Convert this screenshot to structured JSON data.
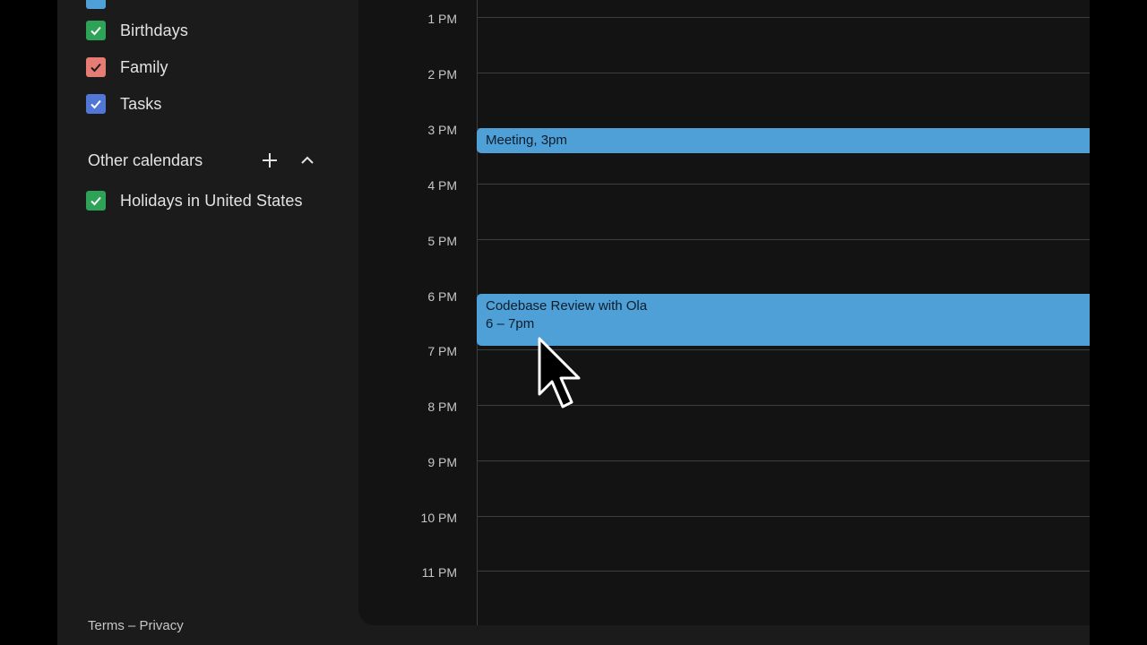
{
  "sidebar": {
    "my_calendars": [
      {
        "label": "Birthdays",
        "color": "#2ea358",
        "checked": true
      },
      {
        "label": "Family",
        "color": "#e67c73",
        "checked": true
      },
      {
        "label": "Tasks",
        "color": "#5177d6",
        "checked": true
      }
    ],
    "partial_top_item_color": "#4fa0d6",
    "other_calendars": {
      "title": "Other calendars",
      "add_icon": "plus-icon",
      "collapse_icon": "chevron-up-icon",
      "items": [
        {
          "label": "Holidays in United States",
          "color": "#2ea358",
          "checked": true
        }
      ]
    },
    "footer": {
      "terms": "Terms",
      "separator": "–",
      "privacy": "Privacy"
    }
  },
  "grid": {
    "hours": [
      "1 PM",
      "2 PM",
      "3 PM",
      "4 PM",
      "5 PM",
      "6 PM",
      "7 PM",
      "8 PM",
      "9 PM",
      "10 PM",
      "11 PM"
    ]
  },
  "events": [
    {
      "title": "Meeting",
      "time": "3pm",
      "color": "#4fa0d6"
    },
    {
      "title": "Codebase Review with Ola",
      "time": "6 – 7pm",
      "color": "#4fa0d6"
    }
  ],
  "colors": {
    "background": "#131314",
    "sidebar": "#1b1b1c",
    "event": "#4fa0d6"
  }
}
